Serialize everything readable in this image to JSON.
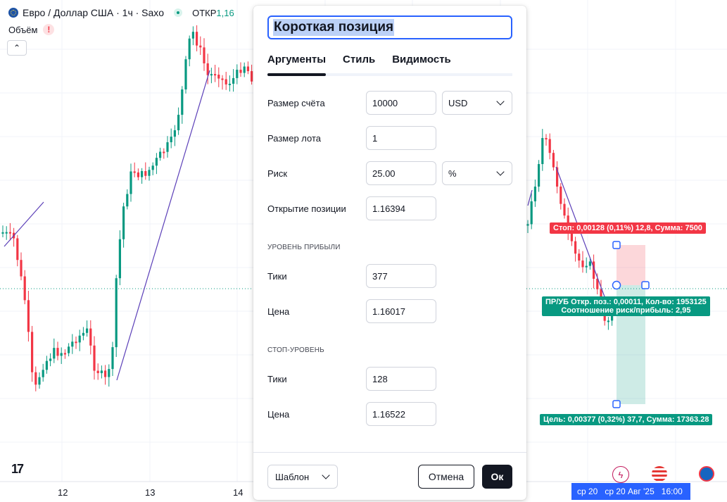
{
  "chart": {
    "symbol_title": "Евро / Доллар США · 1ч · Saxo",
    "open_label": "ОТКР",
    "open_value": "1,16",
    "volume_label": "Объём",
    "warning_glyph": "!",
    "collapse_glyph": "⌃",
    "logo_text": "17",
    "x_ticks": [
      "12",
      "13",
      "14"
    ],
    "crosshair_date_short": "ср 20",
    "crosshair_date_full": "ср 20 Авг '25",
    "crosshair_time": "16:00",
    "stop_tag": "Стоп: 0,00128 (0,11%) 12,8, Сумма: 7500",
    "pnl_tag_line1": "ПР/УБ Откр. поз.: 0,00011, Кол-во: 1953125",
    "pnl_tag_line2": "Соотношение риск/прибыль: 2,95",
    "target_tag": "Цель: 0,00377 (0,32%) 37,7, Сумма: 17363.28",
    "colors": {
      "up": "#089981",
      "down": "#f23645",
      "accent": "#2962ff",
      "trend": "#5b3fb8"
    },
    "icons": [
      "lightning-icon",
      "us-flag-icon",
      "globe-icon"
    ]
  },
  "dialog": {
    "title": "Короткая позиция",
    "tabs": [
      {
        "label": "Аргументы",
        "active": true
      },
      {
        "label": "Стиль",
        "active": false
      },
      {
        "label": "Видимость",
        "active": false
      }
    ],
    "account_size_label": "Размер счёта",
    "account_size_value": "10000",
    "currency_value": "USD",
    "lot_size_label": "Размер лота",
    "lot_size_value": "1",
    "risk_label": "Риск",
    "risk_value": "25.00",
    "risk_unit_value": "%",
    "entry_label": "Открытие позиции",
    "entry_value": "1.16394",
    "profit_section": "УРОВЕНЬ ПРИБЫЛИ",
    "profit_ticks_label": "Тики",
    "profit_ticks_value": "377",
    "profit_price_label": "Цена",
    "profit_price_value": "1.16017",
    "stop_section": "СТОП-УРОВЕНЬ",
    "stop_ticks_label": "Тики",
    "stop_ticks_value": "128",
    "stop_price_label": "Цена",
    "stop_price_value": "1.16522",
    "template_label": "Шаблон",
    "cancel_label": "Отмена",
    "ok_label": "Ок"
  }
}
